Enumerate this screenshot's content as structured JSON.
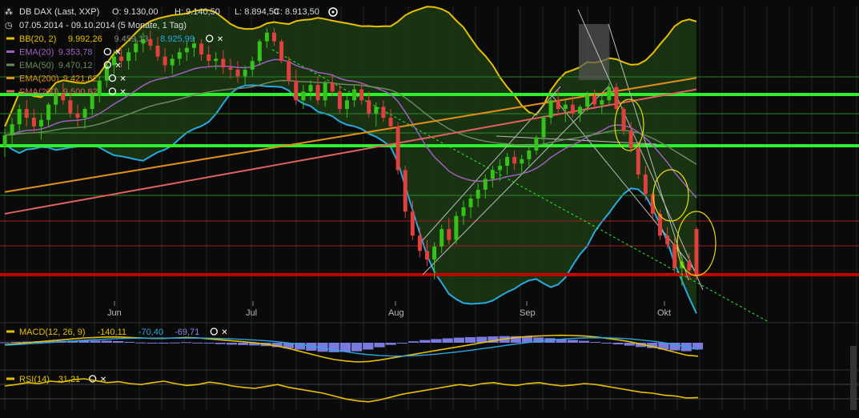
{
  "header": {
    "icon": "chart-type-icon",
    "instrument": "DB DAX (Last, XXP)",
    "open": "O: 9.130,00",
    "high": "H: 9.140,50",
    "low": "L: 8.894,50",
    "close": "C: 8.913,50",
    "period": "07.05.2014 - 09.10.2014 (5 Monate, 1 Tag)"
  },
  "legend": [
    {
      "name": "BB(20, 2)",
      "values": [
        "9.992,26",
        "9.459,13",
        "8.925,99"
      ],
      "color": "#e8c000",
      "value_colors": [
        "#e8c000",
        "#888888",
        "#2aa8e0"
      ]
    },
    {
      "name": "EMA(20)",
      "values": [
        "9.353,78"
      ],
      "color": "#a060c0",
      "value_colors": [
        "#a060c0"
      ]
    },
    {
      "name": "EMA(50)",
      "values": [
        "9.470,12"
      ],
      "color": "#6a8a5a",
      "value_colors": [
        "#6a8a5a"
      ]
    },
    {
      "name": "EMA(200)",
      "values": [
        "9.421,62"
      ],
      "color": "#e0901a",
      "value_colors": [
        "#e0901a"
      ]
    },
    {
      "name": "SMA(200)",
      "values": [
        "9.500,82"
      ],
      "color": "#e06060",
      "value_colors": [
        "#e06060"
      ]
    }
  ],
  "macd_legend": {
    "name": "MACD(12, 26, 9)",
    "values": [
      "-140,11",
      "-70,40",
      "-69,71"
    ],
    "color": "#e8c000",
    "value_colors": [
      "#e8c000",
      "#2aa8e0",
      "#8888ee"
    ]
  },
  "rsi_legend": {
    "name": "RSI(14)",
    "values": [
      "31,21"
    ],
    "color": "#e8c000",
    "value_colors": [
      "#e8c000"
    ]
  },
  "colors": {
    "up": "#36c21a",
    "down": "#e04040",
    "bb": "#e8c000",
    "bb_fill": "#1c3a14",
    "grid": "#1e2a1e",
    "support_green": "#2cf02c",
    "support_red": "#c00000"
  },
  "chart_data": [
    {
      "type": "candlestick",
      "title": "DB DAX (Last, XXP)",
      "x_ticks": [
        "Jun",
        "Jul",
        "Aug",
        "Sep",
        "Okt"
      ],
      "ylim": [
        8800,
        10150
      ],
      "ohlc": [
        [
          9510,
          9590,
          9460,
          9560
        ],
        [
          9560,
          9640,
          9520,
          9610
        ],
        [
          9610,
          9700,
          9580,
          9680
        ],
        [
          9680,
          9720,
          9600,
          9640
        ],
        [
          9640,
          9680,
          9570,
          9600
        ],
        [
          9600,
          9660,
          9540,
          9630
        ],
        [
          9630,
          9710,
          9600,
          9700
        ],
        [
          9700,
          9780,
          9660,
          9750
        ],
        [
          9750,
          9800,
          9700,
          9720
        ],
        [
          9720,
          9760,
          9640,
          9660
        ],
        [
          9660,
          9700,
          9600,
          9640
        ],
        [
          9640,
          9690,
          9590,
          9680
        ],
        [
          9680,
          9760,
          9650,
          9740
        ],
        [
          9740,
          9830,
          9710,
          9810
        ],
        [
          9810,
          9900,
          9780,
          9880
        ],
        [
          9880,
          9950,
          9840,
          9920
        ],
        [
          9920,
          9970,
          9870,
          9900
        ],
        [
          9900,
          9960,
          9860,
          9940
        ],
        [
          9940,
          10000,
          9900,
          9980
        ],
        [
          9980,
          10030,
          9940,
          10000
        ],
        [
          10000,
          10040,
          9950,
          9970
        ],
        [
          9970,
          10010,
          9900,
          9920
        ],
        [
          9920,
          9960,
          9850,
          9880
        ],
        [
          9880,
          9930,
          9840,
          9910
        ],
        [
          9910,
          9960,
          9880,
          9940
        ],
        [
          9940,
          9990,
          9900,
          9960
        ],
        [
          9960,
          10010,
          9920,
          9980
        ],
        [
          9980,
          10000,
          9900,
          9930
        ],
        [
          9930,
          9970,
          9870,
          9900
        ],
        [
          9900,
          9940,
          9860,
          9910
        ],
        [
          9910,
          9950,
          9840,
          9870
        ],
        [
          9870,
          9910,
          9820,
          9860
        ],
        [
          9860,
          9900,
          9800,
          9830
        ],
        [
          9830,
          9880,
          9790,
          9860
        ],
        [
          9860,
          9920,
          9830,
          9900
        ],
        [
          9900,
          10000,
          9880,
          9990
        ],
        [
          9990,
          10050,
          9960,
          10030
        ],
        [
          10030,
          10050,
          9970,
          9990
        ],
        [
          9990,
          10000,
          9890,
          9900
        ],
        [
          9900,
          9920,
          9790,
          9810
        ],
        [
          9810,
          9860,
          9700,
          9720
        ],
        [
          9720,
          9790,
          9680,
          9760
        ],
        [
          9760,
          9810,
          9720,
          9790
        ],
        [
          9790,
          9830,
          9700,
          9720
        ],
        [
          9720,
          9810,
          9690,
          9800
        ],
        [
          9800,
          9840,
          9740,
          9760
        ],
        [
          9760,
          9790,
          9660,
          9680
        ],
        [
          9680,
          9740,
          9640,
          9720
        ],
        [
          9720,
          9790,
          9690,
          9770
        ],
        [
          9770,
          9800,
          9700,
          9720
        ],
        [
          9720,
          9760,
          9640,
          9660
        ],
        [
          9660,
          9710,
          9600,
          9690
        ],
        [
          9690,
          9720,
          9620,
          9640
        ],
        [
          9640,
          9680,
          9580,
          9600
        ],
        [
          9600,
          9620,
          9380,
          9400
        ],
        [
          9400,
          9420,
          9180,
          9210
        ],
        [
          9210,
          9260,
          9080,
          9100
        ],
        [
          9100,
          9140,
          9000,
          9030
        ],
        [
          9030,
          9080,
          8960,
          8990
        ],
        [
          8990,
          9070,
          8900,
          9050
        ],
        [
          9050,
          9150,
          9020,
          9130
        ],
        [
          9130,
          9180,
          9060,
          9080
        ],
        [
          9080,
          9210,
          9060,
          9190
        ],
        [
          9190,
          9260,
          9150,
          9230
        ],
        [
          9230,
          9290,
          9180,
          9270
        ],
        [
          9270,
          9340,
          9230,
          9310
        ],
        [
          9310,
          9380,
          9270,
          9360
        ],
        [
          9360,
          9420,
          9320,
          9400
        ],
        [
          9400,
          9450,
          9350,
          9420
        ],
        [
          9420,
          9480,
          9380,
          9460
        ],
        [
          9460,
          9490,
          9400,
          9430
        ],
        [
          9430,
          9470,
          9380,
          9450
        ],
        [
          9450,
          9510,
          9420,
          9490
        ],
        [
          9490,
          9560,
          9470,
          9550
        ],
        [
          9550,
          9650,
          9520,
          9640
        ],
        [
          9640,
          9730,
          9610,
          9720
        ],
        [
          9720,
          9770,
          9650,
          9680
        ],
        [
          9680,
          9720,
          9620,
          9700
        ],
        [
          9700,
          9740,
          9640,
          9660
        ],
        [
          9660,
          9700,
          9620,
          9690
        ],
        [
          9690,
          9760,
          9670,
          9740
        ],
        [
          9740,
          9770,
          9680,
          9700
        ],
        [
          9700,
          9740,
          9660,
          9720
        ],
        [
          9720,
          9800,
          9700,
          9780
        ],
        [
          9780,
          9800,
          9660,
          9680
        ],
        [
          9680,
          9690,
          9560,
          9580
        ],
        [
          9580,
          9620,
          9480,
          9500
        ],
        [
          9500,
          9530,
          9360,
          9380
        ],
        [
          9380,
          9420,
          9260,
          9290
        ],
        [
          9290,
          9300,
          9180,
          9200
        ],
        [
          9200,
          9220,
          9080,
          9100
        ],
        [
          9100,
          9140,
          9040,
          9060
        ],
        [
          9060,
          9090,
          8930,
          8950
        ],
        [
          8950,
          9000,
          8870,
          8980
        ],
        [
          8980,
          9020,
          8900,
          8940
        ],
        [
          9130,
          9140,
          8894,
          8913
        ]
      ]
    },
    {
      "type": "line",
      "title": "MACD(12, 26, 9)",
      "series": [
        {
          "name": "MACD(12, 26, 9)",
          "values": [
            -20,
            -10,
            0,
            10,
            20,
            30,
            40,
            50,
            55,
            60,
            60,
            55,
            50,
            45,
            45,
            50,
            55,
            50,
            40,
            30,
            20,
            10,
            0,
            -15,
            -35,
            -60,
            -90,
            -120,
            -150,
            -175,
            -190,
            -200,
            -195,
            -180,
            -160,
            -140,
            -120,
            -100,
            -80,
            -60,
            -40,
            -20,
            0,
            20,
            40,
            55,
            65,
            70,
            75,
            78,
            75,
            70,
            60,
            45,
            30,
            10,
            -15,
            -40,
            -70,
            -100,
            -130,
            -140
          ]
        },
        {
          "name": "",
          "values": [
            -25,
            -20,
            -12,
            -5,
            2,
            10,
            18,
            26,
            32,
            38,
            43,
            46,
            48,
            48,
            48,
            48,
            49,
            49,
            47,
            44,
            40,
            34,
            28,
            20,
            10,
            -3,
            -19,
            -37,
            -56,
            -76,
            -94,
            -111,
            -124,
            -133,
            -138,
            -139,
            -135,
            -128,
            -118,
            -106,
            -93,
            -78,
            -62,
            -46,
            -29,
            -13,
            2,
            15,
            27,
            37,
            45,
            50,
            52,
            51,
            47,
            40,
            29,
            16,
            0,
            -20,
            -42,
            -70
          ]
        }
      ],
      "histogram": [
        5,
        10,
        12,
        15,
        18,
        20,
        22,
        24,
        23,
        22,
        17,
        9,
        2,
        -3,
        -3,
        2,
        6,
        1,
        -7,
        -14,
        -20,
        -24,
        -28,
        -35,
        -45,
        -57,
        -71,
        -83,
        -94,
        -99,
        -96,
        -89,
        -71,
        -47,
        -22,
        -1,
        15,
        28,
        38,
        46,
        53,
        58,
        62,
        66,
        69,
        68,
        63,
        55,
        48,
        41,
        30,
        20,
        8,
        -6,
        -17,
        -30,
        -44,
        -56,
        -70,
        -80,
        -88,
        -70
      ]
    },
    {
      "type": "line",
      "title": "RSI(14)",
      "ylim": [
        0,
        100
      ],
      "series": [
        {
          "name": "RSI(14)",
          "values": [
            55,
            58,
            62,
            60,
            65,
            63,
            68,
            70,
            66,
            62,
            64,
            60,
            58,
            62,
            65,
            60,
            56,
            58,
            63,
            60,
            55,
            52,
            50,
            54,
            58,
            52,
            48,
            44,
            40,
            34,
            28,
            24,
            22,
            26,
            32,
            38,
            42,
            46,
            50,
            54,
            58,
            55,
            60,
            62,
            58,
            56,
            60,
            62,
            58,
            55,
            57,
            60,
            58,
            54,
            50,
            46,
            42,
            40,
            36,
            34,
            30,
            31
          ]
        }
      ]
    }
  ]
}
